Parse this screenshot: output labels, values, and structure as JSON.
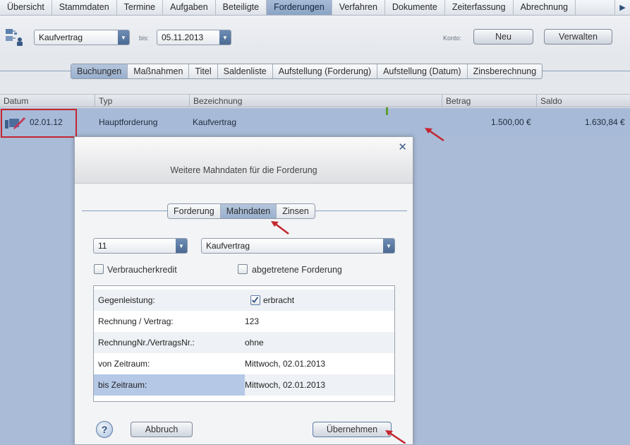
{
  "topnav": {
    "tabs": [
      "Übersicht",
      "Stammdaten",
      "Termine",
      "Aufgaben",
      "Beteiligte",
      "Forderungen",
      "Verfahren",
      "Dokumente",
      "Zeiterfassung",
      "Abrechnung"
    ],
    "active": "Forderungen"
  },
  "toolbar": {
    "type_select": "Kaufvertrag",
    "bis_label": "bis:",
    "date": "05.11.2013",
    "konto_label": "Konto:",
    "new_label": "Neu",
    "manage_label": "Verwalten"
  },
  "subtabs": {
    "items": [
      "Buchungen",
      "Maßnahmen",
      "Titel",
      "Saldenliste",
      "Aufstellung (Forderung)",
      "Aufstellung (Datum)",
      "Zinsberechnung"
    ],
    "active": "Buchungen"
  },
  "table": {
    "columns": [
      "Datum",
      "Typ",
      "Bezeichnung",
      "Betrag",
      "Saldo"
    ],
    "rows": [
      {
        "datum": "02.01.12",
        "typ": "Hauptforderung",
        "bezeichnung": "Kaufvertrag",
        "betrag": "1.500,00 €",
        "saldo": "1.630,84 €"
      }
    ]
  },
  "dialog": {
    "title": "Weitere Mahndaten für die Forderung",
    "tabs": [
      "Forderung",
      "Mahndaten",
      "Zinsen"
    ],
    "active_tab": "Mahndaten",
    "select_number": "11",
    "select_type": "Kaufvertrag",
    "cb_consumer": "Verbraucherkredit",
    "cb_assigned": "abgetretene Forderung",
    "fields": [
      {
        "label": "Gegenleistung:",
        "value": "erbracht"
      },
      {
        "label": "Rechnung / Vertrag:",
        "value": "123"
      },
      {
        "label": "RechnungNr./VertragsNr.:",
        "value": "ohne"
      },
      {
        "label": "von Zeitraum:",
        "value": "Mittwoch, 02.01.2013"
      },
      {
        "label": "bis Zeitraum:",
        "value": "Mittwoch, 02.01.2013"
      }
    ],
    "help": "?",
    "cancel_label": "Abbruch",
    "apply_label": "Übernehmen"
  },
  "colors": {
    "accent": "#8aa3c4",
    "row_highlight": "#a7bad7",
    "annotation_red": "#c4262e"
  }
}
